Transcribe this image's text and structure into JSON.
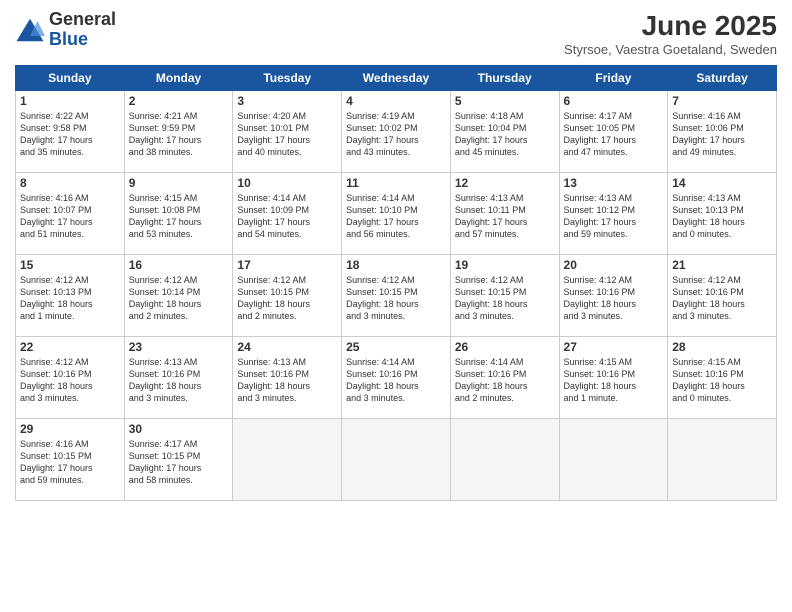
{
  "logo": {
    "general": "General",
    "blue": "Blue"
  },
  "title": "June 2025",
  "subtitle": "Styrsoe, Vaestra Goetaland, Sweden",
  "days_of_week": [
    "Sunday",
    "Monday",
    "Tuesday",
    "Wednesday",
    "Thursday",
    "Friday",
    "Saturday"
  ],
  "weeks": [
    [
      {
        "day": 1,
        "info": "Sunrise: 4:22 AM\nSunset: 9:58 PM\nDaylight: 17 hours\nand 35 minutes."
      },
      {
        "day": 2,
        "info": "Sunrise: 4:21 AM\nSunset: 9:59 PM\nDaylight: 17 hours\nand 38 minutes."
      },
      {
        "day": 3,
        "info": "Sunrise: 4:20 AM\nSunset: 10:01 PM\nDaylight: 17 hours\nand 40 minutes."
      },
      {
        "day": 4,
        "info": "Sunrise: 4:19 AM\nSunset: 10:02 PM\nDaylight: 17 hours\nand 43 minutes."
      },
      {
        "day": 5,
        "info": "Sunrise: 4:18 AM\nSunset: 10:04 PM\nDaylight: 17 hours\nand 45 minutes."
      },
      {
        "day": 6,
        "info": "Sunrise: 4:17 AM\nSunset: 10:05 PM\nDaylight: 17 hours\nand 47 minutes."
      },
      {
        "day": 7,
        "info": "Sunrise: 4:16 AM\nSunset: 10:06 PM\nDaylight: 17 hours\nand 49 minutes."
      }
    ],
    [
      {
        "day": 8,
        "info": "Sunrise: 4:16 AM\nSunset: 10:07 PM\nDaylight: 17 hours\nand 51 minutes."
      },
      {
        "day": 9,
        "info": "Sunrise: 4:15 AM\nSunset: 10:08 PM\nDaylight: 17 hours\nand 53 minutes."
      },
      {
        "day": 10,
        "info": "Sunrise: 4:14 AM\nSunset: 10:09 PM\nDaylight: 17 hours\nand 54 minutes."
      },
      {
        "day": 11,
        "info": "Sunrise: 4:14 AM\nSunset: 10:10 PM\nDaylight: 17 hours\nand 56 minutes."
      },
      {
        "day": 12,
        "info": "Sunrise: 4:13 AM\nSunset: 10:11 PM\nDaylight: 17 hours\nand 57 minutes."
      },
      {
        "day": 13,
        "info": "Sunrise: 4:13 AM\nSunset: 10:12 PM\nDaylight: 17 hours\nand 59 minutes."
      },
      {
        "day": 14,
        "info": "Sunrise: 4:13 AM\nSunset: 10:13 PM\nDaylight: 18 hours\nand 0 minutes."
      }
    ],
    [
      {
        "day": 15,
        "info": "Sunrise: 4:12 AM\nSunset: 10:13 PM\nDaylight: 18 hours\nand 1 minute."
      },
      {
        "day": 16,
        "info": "Sunrise: 4:12 AM\nSunset: 10:14 PM\nDaylight: 18 hours\nand 2 minutes."
      },
      {
        "day": 17,
        "info": "Sunrise: 4:12 AM\nSunset: 10:15 PM\nDaylight: 18 hours\nand 2 minutes."
      },
      {
        "day": 18,
        "info": "Sunrise: 4:12 AM\nSunset: 10:15 PM\nDaylight: 18 hours\nand 3 minutes."
      },
      {
        "day": 19,
        "info": "Sunrise: 4:12 AM\nSunset: 10:15 PM\nDaylight: 18 hours\nand 3 minutes."
      },
      {
        "day": 20,
        "info": "Sunrise: 4:12 AM\nSunset: 10:16 PM\nDaylight: 18 hours\nand 3 minutes."
      },
      {
        "day": 21,
        "info": "Sunrise: 4:12 AM\nSunset: 10:16 PM\nDaylight: 18 hours\nand 3 minutes."
      }
    ],
    [
      {
        "day": 22,
        "info": "Sunrise: 4:12 AM\nSunset: 10:16 PM\nDaylight: 18 hours\nand 3 minutes."
      },
      {
        "day": 23,
        "info": "Sunrise: 4:13 AM\nSunset: 10:16 PM\nDaylight: 18 hours\nand 3 minutes."
      },
      {
        "day": 24,
        "info": "Sunrise: 4:13 AM\nSunset: 10:16 PM\nDaylight: 18 hours\nand 3 minutes."
      },
      {
        "day": 25,
        "info": "Sunrise: 4:14 AM\nSunset: 10:16 PM\nDaylight: 18 hours\nand 3 minutes."
      },
      {
        "day": 26,
        "info": "Sunrise: 4:14 AM\nSunset: 10:16 PM\nDaylight: 18 hours\nand 2 minutes."
      },
      {
        "day": 27,
        "info": "Sunrise: 4:15 AM\nSunset: 10:16 PM\nDaylight: 18 hours\nand 1 minute."
      },
      {
        "day": 28,
        "info": "Sunrise: 4:15 AM\nSunset: 10:16 PM\nDaylight: 18 hours\nand 0 minutes."
      }
    ],
    [
      {
        "day": 29,
        "info": "Sunrise: 4:16 AM\nSunset: 10:15 PM\nDaylight: 17 hours\nand 59 minutes."
      },
      {
        "day": 30,
        "info": "Sunrise: 4:17 AM\nSunset: 10:15 PM\nDaylight: 17 hours\nand 58 minutes."
      },
      {
        "day": null,
        "info": ""
      },
      {
        "day": null,
        "info": ""
      },
      {
        "day": null,
        "info": ""
      },
      {
        "day": null,
        "info": ""
      },
      {
        "day": null,
        "info": ""
      }
    ]
  ]
}
